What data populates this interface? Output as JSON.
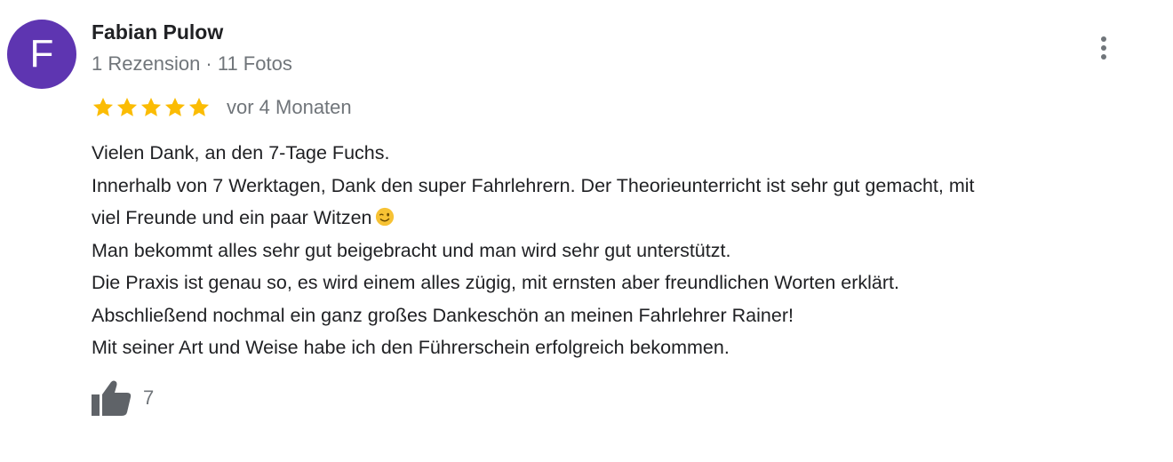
{
  "reviewer": {
    "initial": "F",
    "avatar_color": "#5e35b1",
    "name": "Fabian Pulow",
    "meta": "1 Rezension · 11 Fotos"
  },
  "review": {
    "rating": 5,
    "max_rating": 5,
    "star_color": "#fbbc04",
    "date": "vor 4 Monaten",
    "lines": [
      "Vielen Dank, an den 7-Tage Fuchs.",
      "Innerhalb von 7 Werktagen, Dank den super Fahrlehrern. Der Theorieunterricht ist sehr gut gemacht, mit",
      "viel Freunde und ein paar Witzen",
      "Man bekommt alles sehr gut beigebracht und man wird sehr gut unterstützt.",
      "Die Praxis ist genau so, es wird einem alles zügig, mit ernsten aber freundlichen Worten erklärt.",
      "Abschließend nochmal ein ganz großes Dankeschön an meinen Fahrlehrer Rainer!",
      "Mit seiner Art und Weise habe ich den Führerschein erfolgreich bekommen."
    ],
    "emoji": "winking-face"
  },
  "actions": {
    "more_icon": "more-vert-icon",
    "like_icon": "thumbs-up-icon",
    "like_count": "7"
  }
}
